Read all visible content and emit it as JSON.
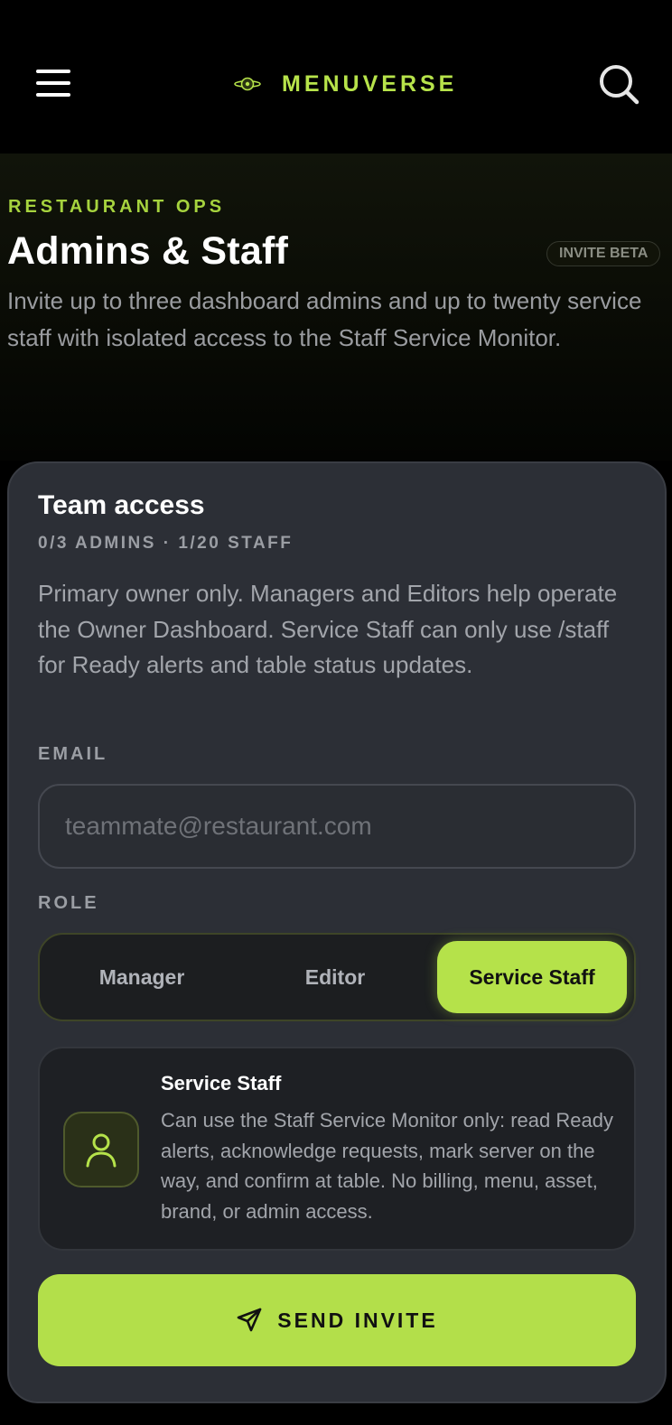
{
  "header": {
    "brand_name": "MENUVERSE",
    "menu_icon": "hamburger-menu-icon",
    "search_icon": "search-icon",
    "logo_icon": "saturn-logo-icon",
    "accent_color": "#b7e34a"
  },
  "hero": {
    "eyebrow": "RESTAURANT OPS",
    "title": "Admins & Staff",
    "badge": "INVITE BETA",
    "description": "Invite up to three dashboard admins and up to twenty service staff with isolated access to the Staff Service Monitor."
  },
  "team_access": {
    "title": "Team access",
    "stats": "0/3 ADMINS · 1/20 STAFF",
    "description": "Primary owner only. Managers and Editors help operate the Owner Dashboard. Service Staff can only use /staff for Ready alerts and table status updates.",
    "email_label": "EMAIL",
    "email_placeholder": "teammate@restaurant.com",
    "email_value": "",
    "role_label": "ROLE",
    "roles": [
      "Manager",
      "Editor",
      "Service Staff"
    ],
    "selected_role": "Service Staff",
    "role_card": {
      "icon": "user-icon",
      "title": "Service Staff",
      "description": "Can use the Staff Service Monitor only: read Ready alerts, acknowledge requests, mark server on the way, and confirm at table. No billing, menu, asset, brand, or admin access."
    },
    "send_button": {
      "icon": "send-icon",
      "label": "SEND INVITE"
    }
  }
}
